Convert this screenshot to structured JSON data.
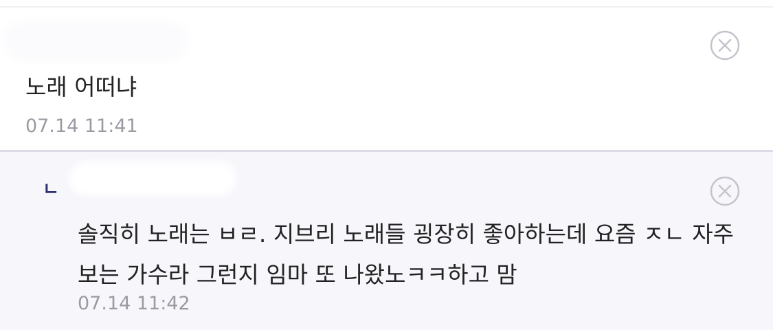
{
  "comment": {
    "text": "노래 어떠냐",
    "time": "07.14 11:41",
    "delete_icon": "circle-x-icon"
  },
  "reply": {
    "marker": "ㄴ",
    "text": "솔직히 노래는 ㅂㄹ. 지브리 노래들 굉장히 좋아하는데 요즘 ㅈㄴ 자주 보는 가수라 그런지 임마 또 나왔노ㅋㅋ하고 맘",
    "time": "07.14 11:42",
    "delete_icon": "circle-x-icon"
  },
  "colors": {
    "reply_background": "#f6f6fb",
    "reply_marker": "#2e3470",
    "timestamp": "#9a9aa2",
    "icon": "#c4c4cc"
  }
}
